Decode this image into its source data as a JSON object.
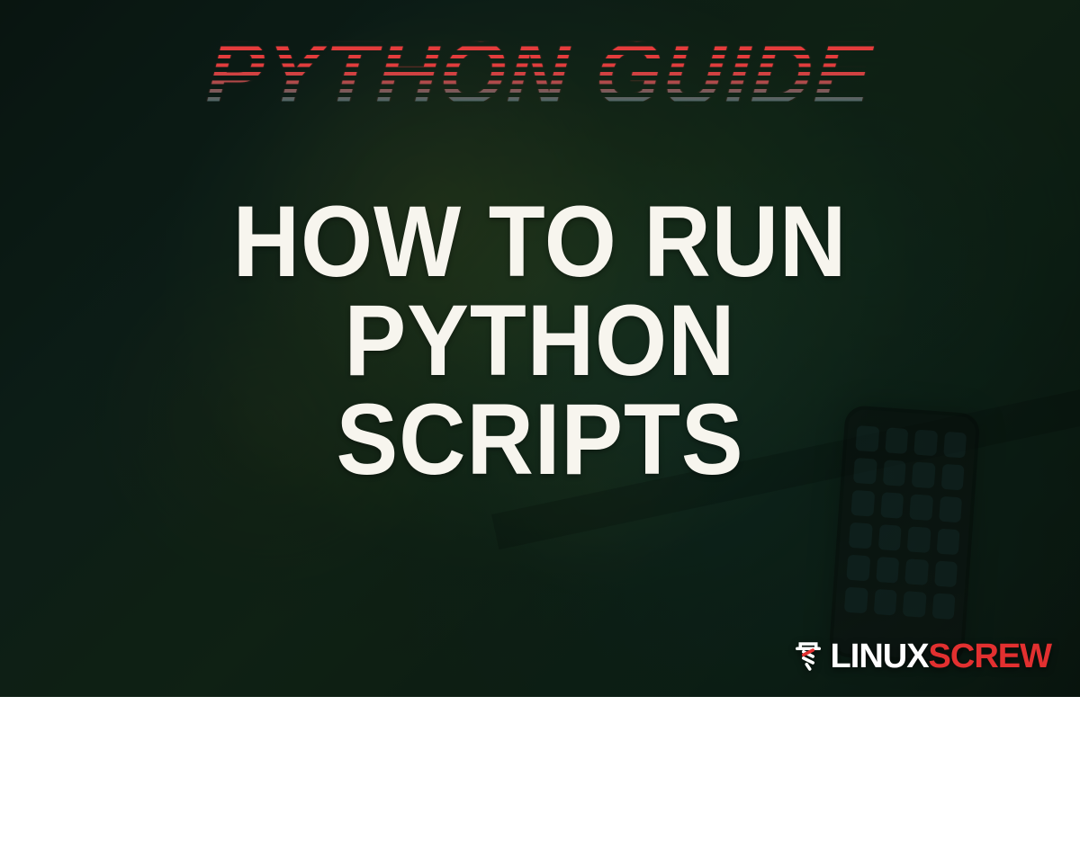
{
  "banner": {
    "supertitle": "PYTHON GUIDE",
    "title_line1": "HOW TO RUN PYTHON",
    "title_line2": "SCRIPTS"
  },
  "brand": {
    "word1": "LINUX",
    "word2": "SCREW"
  }
}
